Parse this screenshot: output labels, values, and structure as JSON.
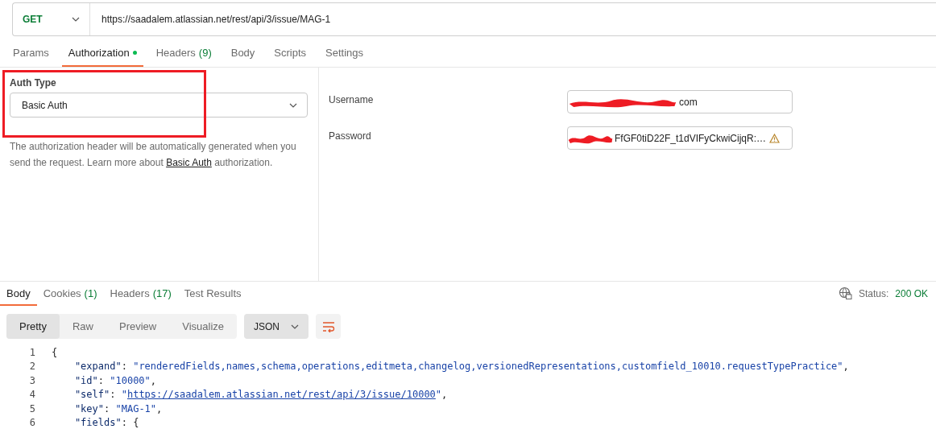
{
  "request": {
    "method": "GET",
    "url": "https://saadalem.atlassian.net/rest/api/3/issue/MAG-1"
  },
  "request_tabs": [
    {
      "label": "Params",
      "selected": false
    },
    {
      "label": "Authorization",
      "dot": true,
      "selected": true
    },
    {
      "label": "Headers",
      "count": "(9)",
      "selected": false
    },
    {
      "label": "Body",
      "selected": false
    },
    {
      "label": "Scripts",
      "selected": false
    },
    {
      "label": "Settings",
      "selected": false
    }
  ],
  "auth": {
    "label": "Auth Type",
    "type": "Basic Auth",
    "highlighted": true,
    "description": "The authorization header will be automatically generated when you send the request. Learn more about ",
    "link": "Basic Auth",
    "description_end": "authorization."
  },
  "credentials": [
    {
      "label": "Username",
      "value": "com",
      "redacted": true,
      "warning": false
    },
    {
      "label": "Password",
      "value": "FfGF0tiD22F_t1dVIFyCkwiCijqR:…",
      "redacted": true,
      "warning": true
    }
  ],
  "response_tabs": [
    {
      "label": "Body",
      "selected": true
    },
    {
      "label": "Cookies",
      "count": "(1)",
      "selected": false
    },
    {
      "label": "Headers",
      "count": "(17)",
      "selected": false
    },
    {
      "label": "Test Results",
      "selected": false
    }
  ],
  "status": {
    "label": "Status:",
    "value": "200 OK"
  },
  "view_modes": [
    {
      "label": "Pretty",
      "selected": true
    },
    {
      "label": "Raw",
      "selected": false
    },
    {
      "label": "Preview",
      "selected": false
    },
    {
      "label": "Visualize",
      "selected": false
    }
  ],
  "format": "JSON",
  "code_lines": [
    {
      "number": "1",
      "tokens": [
        {
          "kind": "punct",
          "text": "{"
        }
      ]
    },
    {
      "number": "2",
      "tokens": [
        {
          "kind": "key",
          "text": "    \"expand\""
        },
        {
          "kind": "punct",
          "text": ": "
        },
        {
          "kind": "string",
          "text": "\"renderedFields,names,schema,operations,editmeta,changelog,versionedRepresentations,customfield_10010.requestTypePractice\""
        },
        {
          "kind": "punct",
          "text": ","
        }
      ]
    },
    {
      "number": "3",
      "tokens": [
        {
          "kind": "key",
          "text": "    \"id\""
        },
        {
          "kind": "punct",
          "text": ": "
        },
        {
          "kind": "string",
          "text": "\"10000\""
        },
        {
          "kind": "punct",
          "text": ","
        }
      ]
    },
    {
      "number": "4",
      "tokens": [
        {
          "kind": "key",
          "text": "    \"self\""
        },
        {
          "kind": "punct",
          "text": ": "
        },
        {
          "kind": "string",
          "text": "\""
        },
        {
          "kind": "link",
          "text": "https://saadalem.atlassian.net/rest/api/3/issue/10000"
        },
        {
          "kind": "string",
          "text": "\""
        },
        {
          "kind": "punct",
          "text": ","
        }
      ]
    },
    {
      "number": "5",
      "tokens": [
        {
          "kind": "key",
          "text": "    \"key\""
        },
        {
          "kind": "punct",
          "text": ": "
        },
        {
          "kind": "string",
          "text": "\"MAG-1\""
        },
        {
          "kind": "punct",
          "text": ","
        }
      ]
    },
    {
      "number": "6",
      "tokens": [
        {
          "kind": "key",
          "text": "    \"fields\""
        },
        {
          "kind": "punct",
          "text": ": {"
        }
      ]
    }
  ]
}
